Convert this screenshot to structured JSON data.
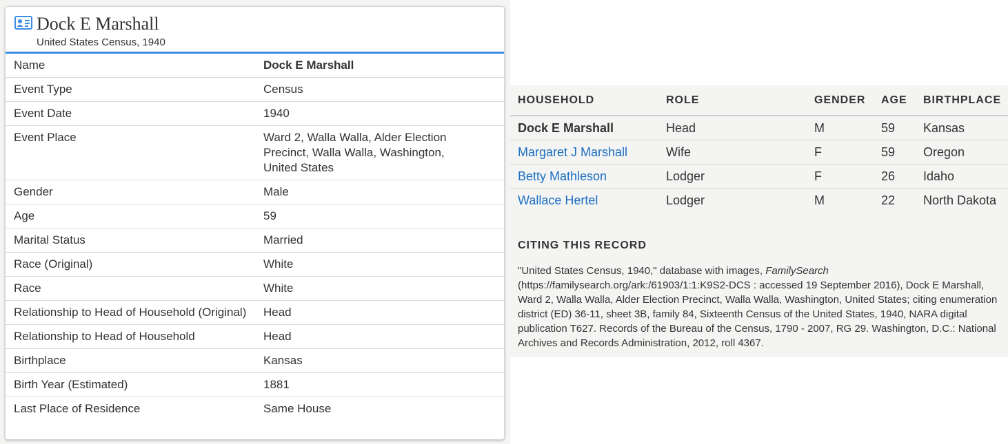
{
  "record": {
    "title": "Dock E Marshall",
    "subtitle": "United States Census, 1940",
    "icon": "person-card-icon",
    "accent_color": "#3a8ee6",
    "facts": [
      {
        "label": "Name",
        "value": "Dock E Marshall"
      },
      {
        "label": "Event Type",
        "value": "Census"
      },
      {
        "label": "Event Date",
        "value": "1940"
      },
      {
        "label": "Event Place",
        "value": "Ward 2, Walla Walla, Alder Election Precinct, Walla Walla, Washington, United States"
      },
      {
        "label": "Gender",
        "value": "Male"
      },
      {
        "label": "Age",
        "value": "59"
      },
      {
        "label": "Marital Status",
        "value": "Married"
      },
      {
        "label": "Race (Original)",
        "value": "White"
      },
      {
        "label": "Race",
        "value": "White"
      },
      {
        "label": "Relationship to Head of Household (Original)",
        "value": "Head"
      },
      {
        "label": "Relationship to Head of Household",
        "value": "Head"
      },
      {
        "label": "Birthplace",
        "value": "Kansas"
      },
      {
        "label": "Birth Year (Estimated)",
        "value": "1881"
      },
      {
        "label": "Last Place of Residence",
        "value": "Same House"
      }
    ]
  },
  "household": {
    "headers": {
      "household": "HOUSEHOLD",
      "role": "ROLE",
      "gender": "GENDER",
      "age": "AGE",
      "birthplace": "BIRTHPLACE"
    },
    "link_color": "#1a6fc4",
    "members": [
      {
        "name": "Dock E Marshall",
        "role": "Head",
        "gender": "M",
        "age": "59",
        "birthplace": "Kansas"
      },
      {
        "name": "Margaret J Marshall",
        "role": "Wife",
        "gender": "F",
        "age": "59",
        "birthplace": "Oregon"
      },
      {
        "name": "Betty Mathleson",
        "role": "Lodger",
        "gender": "F",
        "age": "26",
        "birthplace": "Idaho"
      },
      {
        "name": "Wallace Hertel",
        "role": "Lodger",
        "gender": "M",
        "age": "22",
        "birthplace": "North Dakota"
      }
    ]
  },
  "citing": {
    "heading": "CITING THIS RECORD",
    "text_before": "\"United States Census, 1940,\" database with images, ",
    "source_name": "FamilySearch",
    "text_after": " (https://familysearch.org/ark:/61903/1:1:K9S2-DCS : accessed 19 September 2016), Dock E Marshall, Ward 2, Walla Walla, Alder Election Precinct, Walla Walla, Washington, United States; citing enumeration district (ED) 36-11, sheet 3B, family 84, Sixteenth Census of the United States, 1940, NARA digital publication T627. Records of the Bureau of the Census, 1790 - 2007, RG 29. Washington, D.C.: National Archives and Records Administration, 2012, roll 4367."
  }
}
